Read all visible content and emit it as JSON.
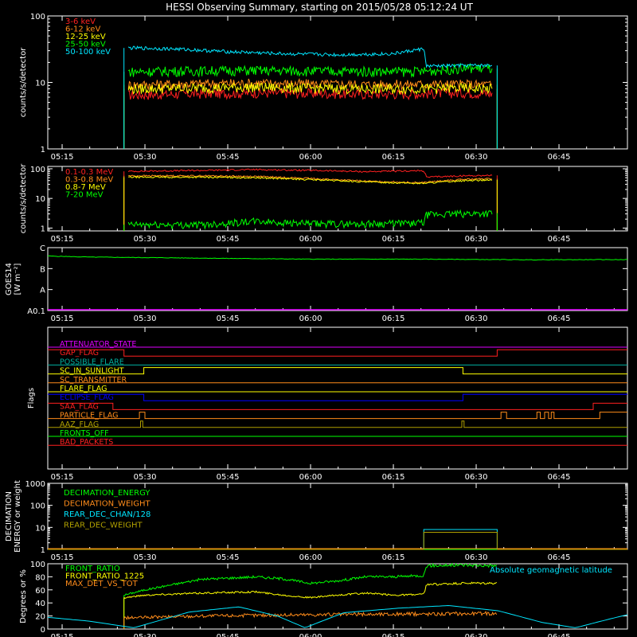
{
  "title": "HESSI Observing Summary, starting on 2015/05/28 05:12:24 UT",
  "colors": {
    "background": "#000000",
    "axes": "#ffffff",
    "red": "#ff2020",
    "orange": "#ff8c1a",
    "yellow": "#ffff00",
    "green": "#00ff00",
    "cyan": "#00e6ff",
    "magenta": "#e000ff",
    "blue": "#0000ff",
    "olive": "#b0a000",
    "teal": "#00b0a0"
  },
  "time_axis": {
    "ticks": [
      "05:15",
      "05:30",
      "05:45",
      "06:00",
      "06:15",
      "06:30",
      "06:45"
    ],
    "tick_minutes": [
      15,
      30,
      45,
      60,
      75,
      90,
      105
    ],
    "range_minutes": [
      12.4,
      117.4
    ]
  },
  "chart_data": [
    {
      "id": "low_energy",
      "type": "line",
      "ylabel": "counts/s/detector",
      "yscale": "log",
      "ylim": [
        1,
        100
      ],
      "ytick_labels": [
        "1",
        "10",
        "100"
      ],
      "ytick_values": [
        1,
        10,
        100
      ],
      "data_window_minutes": [
        26.2,
        93.8
      ],
      "series": [
        {
          "name": "3-6 keV",
          "color": "#ff2020",
          "x": [
            27,
            40,
            50,
            60,
            70,
            80,
            88,
            93
          ],
          "y": [
            6.5,
            6.8,
            7.0,
            6.9,
            6.7,
            6.8,
            7.0,
            6.8
          ]
        },
        {
          "name": "6-12 keV",
          "color": "#ff8c1a",
          "x": [
            27,
            40,
            50,
            60,
            70,
            80,
            88,
            93
          ],
          "y": [
            9.2,
            9.6,
            9.8,
            9.5,
            9.3,
            9.4,
            9.4,
            9.2
          ]
        },
        {
          "name": "12-25 keV",
          "color": "#ffff00",
          "x": [
            27,
            40,
            50,
            60,
            70,
            80,
            88,
            93
          ],
          "y": [
            8.0,
            8.3,
            8.5,
            8.2,
            8.0,
            8.1,
            8.2,
            8.0
          ]
        },
        {
          "name": "25-50 keV",
          "color": "#00ff00",
          "x": [
            27,
            40,
            50,
            60,
            70,
            80,
            88,
            93
          ],
          "y": [
            14.5,
            15.0,
            15.2,
            14.8,
            14.7,
            14.6,
            16.5,
            16.2
          ]
        },
        {
          "name": "50-100 keV",
          "color": "#00e6ff",
          "x": [
            27,
            35,
            45,
            55,
            65,
            75,
            80.5,
            81,
            88,
            93
          ],
          "y": [
            33,
            32,
            29,
            27,
            26,
            27,
            32,
            17.5,
            18,
            18
          ]
        }
      ]
    },
    {
      "id": "high_energy",
      "type": "line",
      "ylabel": "counts/s/detector",
      "yscale": "log",
      "ylim": [
        0.8,
        120
      ],
      "ytick_labels": [
        "1",
        "10",
        "100"
      ],
      "ytick_values": [
        1,
        10,
        100
      ],
      "data_window_minutes": [
        26.2,
        93.8
      ],
      "series": [
        {
          "name": "0.1-0.3 MeV",
          "color": "#ff2020",
          "x": [
            27,
            40,
            50,
            60,
            70,
            80.5,
            81,
            88,
            93
          ],
          "y": [
            82,
            88,
            94,
            88,
            80,
            86,
            52,
            58,
            60
          ]
        },
        {
          "name": "0.3-0.8 MeV",
          "color": "#ff8c1a",
          "x": [
            27,
            40,
            50,
            60,
            70,
            80,
            88,
            93
          ],
          "y": [
            58,
            58,
            55,
            47,
            38,
            34,
            44,
            46
          ]
        },
        {
          "name": "0.8-7 MeV",
          "color": "#ffff00",
          "x": [
            27,
            40,
            50,
            60,
            70,
            80,
            88,
            93
          ],
          "y": [
            52,
            52,
            50,
            43,
            36,
            32,
            40,
            42
          ]
        },
        {
          "name": "7-20 MeV",
          "color": "#00ff00",
          "x": [
            27,
            40,
            50,
            60,
            70,
            80.5,
            81,
            88,
            93
          ],
          "y": [
            1.3,
            1.3,
            1.7,
            1.4,
            1.4,
            1.5,
            2.8,
            3.1,
            3.2
          ]
        }
      ]
    },
    {
      "id": "goes",
      "type": "line",
      "ylabel_lines": [
        "GOES14",
        "[W m⁻²]"
      ],
      "ytick_labels": [
        "A0.1",
        "A",
        "B",
        "C"
      ],
      "ytick_values": [
        0,
        1,
        2,
        3
      ],
      "ylim": [
        0,
        3
      ],
      "series": [
        {
          "name": "GOES flux",
          "color": "#00ff00",
          "x": [
            12.4,
            20,
            40,
            60,
            80,
            100,
            117.4
          ],
          "y": [
            2.6,
            2.55,
            2.5,
            2.45,
            2.45,
            2.42,
            2.43
          ]
        }
      ]
    },
    {
      "id": "flags",
      "type": "line",
      "ylabel": "Flags",
      "flag_rows": [
        {
          "name": "ATTENUATOR_STATE",
          "color": "#e000ff",
          "steps": [
            [
              12.4,
              0
            ]
          ]
        },
        {
          "name": "GAP_FLAG",
          "color": "#ff2020",
          "steps": [
            [
              12.4,
              1
            ],
            [
              26.2,
              0
            ],
            [
              93.8,
              1
            ]
          ]
        },
        {
          "name": "POSSIBLE_FLARE",
          "color": "#00b0a0",
          "steps": [
            [
              12.4,
              0
            ]
          ]
        },
        {
          "name": "SC_IN_SUNLIGHT",
          "color": "#ffff00",
          "steps": [
            [
              12.4,
              0
            ],
            [
              29.8,
              1
            ],
            [
              87.6,
              0
            ]
          ]
        },
        {
          "name": "SC_TRANSMITTER",
          "color": "#ff8c1a",
          "steps": [
            [
              12.4,
              0
            ]
          ]
        },
        {
          "name": "FLARE_FLAG",
          "color": "#ffff00",
          "steps": [
            [
              12.4,
              0
            ]
          ]
        },
        {
          "name": "ECLIPSE_FLAG",
          "color": "#0000ff",
          "steps": [
            [
              12.4,
              1
            ],
            [
              29.8,
              0
            ],
            [
              87.6,
              1
            ]
          ]
        },
        {
          "name": "SAA_FLAG",
          "color": "#ff2020",
          "steps": [
            [
              12.4,
              1
            ],
            [
              24.2,
              0
            ],
            [
              111.2,
              1
            ]
          ]
        },
        {
          "name": "PARTICLE_FLAG",
          "color": "#ff8c1a",
          "steps": [
            [
              12.4,
              0
            ],
            [
              29.0,
              1
            ],
            [
              30.0,
              0
            ],
            [
              94.5,
              1
            ],
            [
              95.5,
              0
            ],
            [
              101.0,
              1
            ],
            [
              101.6,
              0
            ],
            [
              102.4,
              1
            ],
            [
              103.1,
              0
            ],
            [
              103.6,
              1
            ],
            [
              104.1,
              0
            ],
            [
              112.4,
              1
            ],
            [
              117.4,
              1
            ]
          ]
        },
        {
          "name": "AAZ_FLAG",
          "color": "#b0a000",
          "steps": [
            [
              12.4,
              0
            ],
            [
              29.2,
              1
            ],
            [
              29.6,
              0
            ],
            [
              87.4,
              1
            ],
            [
              87.8,
              0
            ]
          ]
        },
        {
          "name": "FRONTS_OFF",
          "color": "#00ff00",
          "steps": [
            [
              12.4,
              0
            ]
          ]
        },
        {
          "name": "BAD_PACKETS",
          "color": "#ff2020",
          "steps": [
            [
              12.4,
              0
            ]
          ]
        }
      ]
    },
    {
      "id": "decimation",
      "type": "line",
      "ylabel_lines": [
        "DECIMATION",
        "ENERGY or weight"
      ],
      "yscale": "log",
      "ylim": [
        1,
        1000
      ],
      "ytick_labels": [
        "1",
        "10",
        "100",
        "1000"
      ],
      "ytick_values": [
        1,
        10,
        100,
        1000
      ],
      "series": [
        {
          "name": "DECIMATION_ENERGY",
          "color": "#00ff00",
          "x": [
            12.4,
            117.4
          ],
          "y": [
            1,
            1
          ]
        },
        {
          "name": "DECIMATION_WEIGHT",
          "color": "#ff8c1a",
          "x": [
            12.4,
            117.4
          ],
          "y": [
            1,
            1
          ]
        },
        {
          "name": "REAR_DEC_CHAN/128",
          "color": "#00e6ff",
          "x": [
            12.4,
            80.5,
            80.5,
            93.8,
            93.8,
            117.4
          ],
          "y": [
            1,
            1,
            8,
            8,
            1,
            1
          ]
        },
        {
          "name": "REAR_DEC_WEIGHT",
          "color": "#b0a000",
          "x": [
            12.4,
            80.5,
            80.5,
            93.8,
            93.8,
            117.4
          ],
          "y": [
            1,
            1,
            6,
            6,
            1,
            1
          ]
        }
      ]
    },
    {
      "id": "ratios",
      "type": "line",
      "ylabel": "Degrees or %",
      "ylim": [
        0,
        100
      ],
      "ytick_labels": [
        "0",
        "20",
        "40",
        "60",
        "80",
        "100"
      ],
      "ytick_values": [
        0,
        20,
        40,
        60,
        80,
        100
      ],
      "annotation": "Absolute geomagnetic latitude",
      "series": [
        {
          "name": "FRONT_RATIO",
          "color": "#00ff00",
          "x": [
            26.2,
            30,
            40,
            50,
            55,
            60,
            65,
            70,
            75,
            80.5,
            81,
            88,
            93.8
          ],
          "y": [
            52,
            60,
            76,
            80,
            77,
            70,
            74,
            80,
            80,
            82,
            97,
            98,
            97
          ]
        },
        {
          "name": "FRONT_RATIO_1225",
          "color": "#ffff00",
          "x": [
            26.2,
            30,
            40,
            50,
            55,
            60,
            65,
            70,
            75,
            80.5,
            81,
            88,
            93.8
          ],
          "y": [
            48,
            52,
            55,
            57,
            52,
            48,
            52,
            55,
            52,
            53,
            68,
            70,
            70
          ]
        },
        {
          "name": "MAX_DET_VS_TOT",
          "color": "#ff8c1a",
          "x": [
            26.2,
            40,
            60,
            80,
            93.8
          ],
          "y": [
            17,
            20,
            22,
            23,
            24
          ]
        },
        {
          "name": "Absolute geomagnetic latitude",
          "color": "#00e6ff",
          "x": [
            12.4,
            20,
            28,
            38,
            47,
            54,
            59,
            66,
            76,
            85,
            94,
            102,
            108,
            114,
            117.4
          ],
          "y": [
            18,
            12,
            2,
            26,
            34,
            20,
            2,
            25,
            32,
            36,
            28,
            10,
            2,
            15,
            22
          ]
        }
      ]
    }
  ]
}
